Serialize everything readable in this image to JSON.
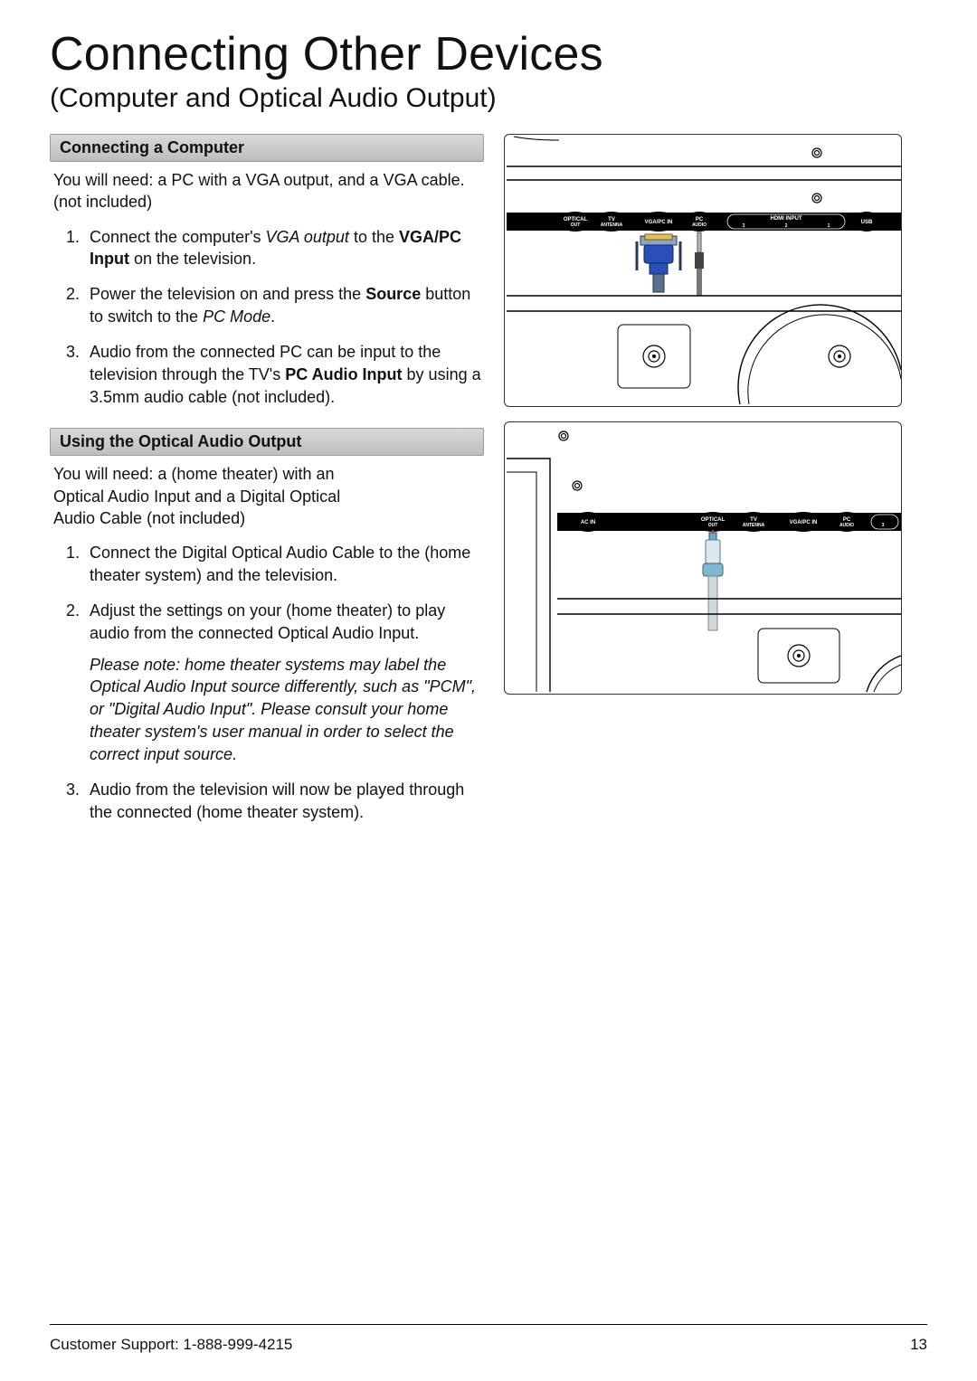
{
  "title": "Connecting Other Devices",
  "subtitle": "(Computer and Optical Audio Output)",
  "section1": {
    "heading": "Connecting a Computer",
    "intro": "You will need: a PC with a VGA output, and a VGA cable. (not included)",
    "step1_a": "Connect the computer's ",
    "step1_i": "VGA output",
    "step1_b": " to the ",
    "step1_bold": "VGA/PC Input",
    "step1_c": " on the television.",
    "step2_a": "Power the television on and press the ",
    "step2_bold": "Source",
    "step2_b": " button to switch to the ",
    "step2_i": "PC Mode",
    "step2_c": ".",
    "step3_a": "Audio from the connected PC can be input to the television through the TV's ",
    "step3_bold": "PC Audio Input",
    "step3_b": " by using a 3.5mm audio cable (not included)."
  },
  "section2": {
    "heading": "Using the Optical Audio Output",
    "intro": "You will need: a (home theater) with an Optical Audio Input and a Digital Optical Audio Cable (not included)",
    "step1": "Connect the Digital Optical Audio Cable to the (home theater system) and the television.",
    "step2": "Adjust the settings on your (home theater) to play audio from the connected Optical Audio Input.",
    "note": "Please note: home theater systems may label the Optical Audio Input source differently, such as \"PCM\", or \"Digital Audio Input\". Please consult your home theater system's user manual in order to select the correct input source.",
    "step3": "Audio from the television will now be played through the connected (home theater system)."
  },
  "fig1": {
    "labels": {
      "optical1": "OPTICAL",
      "optical2": "OUT",
      "tv1": "TV",
      "tv2": "ANTENNA",
      "vga": "VGA/PC IN",
      "pc1": "PC",
      "pc2": "AUDIO",
      "hdmi": "HDMI INPUT",
      "h3": "3",
      "h2": "2",
      "h1": "1",
      "usb": "USB"
    }
  },
  "fig2": {
    "labels": {
      "acin": "AC IN",
      "optical1": "OPTICAL",
      "optical2": "OUT",
      "tv1": "TV",
      "tv2": "ANTENNA",
      "vga": "VGA/PC IN",
      "pc1": "PC",
      "pc2": "AUDIO",
      "three": "3"
    }
  },
  "footer": {
    "support": "Customer Support: 1-888-999-4215",
    "page": "13"
  }
}
